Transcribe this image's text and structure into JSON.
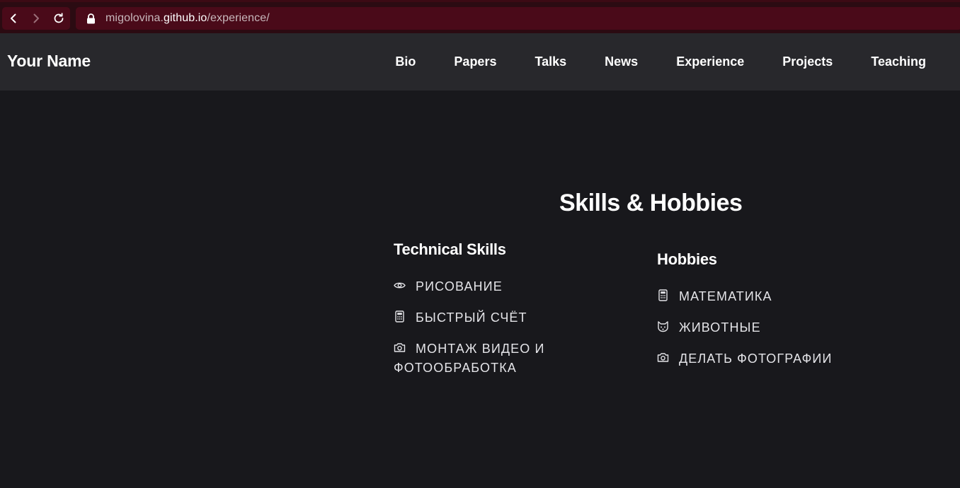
{
  "browser": {
    "url_host_prefix": "migolovina.",
    "url_host": "github.io",
    "url_path": "/experience/"
  },
  "header": {
    "brand": "Your Name",
    "menu": [
      {
        "label": "Bio"
      },
      {
        "label": "Papers"
      },
      {
        "label": "Talks"
      },
      {
        "label": "News"
      },
      {
        "label": "Experience"
      },
      {
        "label": "Projects"
      },
      {
        "label": "Teaching"
      }
    ]
  },
  "main": {
    "title": "Skills & Hobbies",
    "technical": {
      "heading": "Technical Skills",
      "items": [
        {
          "icon": "eye-icon",
          "label": "РИСОВАНИЕ"
        },
        {
          "icon": "calculator-icon",
          "label": "БЫСТРЫЙ СЧЁТ"
        },
        {
          "icon": "camera-icon",
          "label": "МОНТАЖ ВИДЕО И ФОТООБРАБОТКА"
        }
      ]
    },
    "hobbies": {
      "heading": "Hobbies",
      "items": [
        {
          "icon": "calculator-icon",
          "label": "МАТЕМАТИКА"
        },
        {
          "icon": "cat-icon",
          "label": "ЖИВОТНЫЕ"
        },
        {
          "icon": "camera-icon",
          "label": "ДЕЛАТЬ ФОТОГРАФИИ"
        }
      ]
    }
  },
  "colors": {
    "chrome_bg": "#2b0b12",
    "urlbar_bg": "#4a0a19",
    "header_bg": "#28282c",
    "page_bg": "#18181c"
  }
}
